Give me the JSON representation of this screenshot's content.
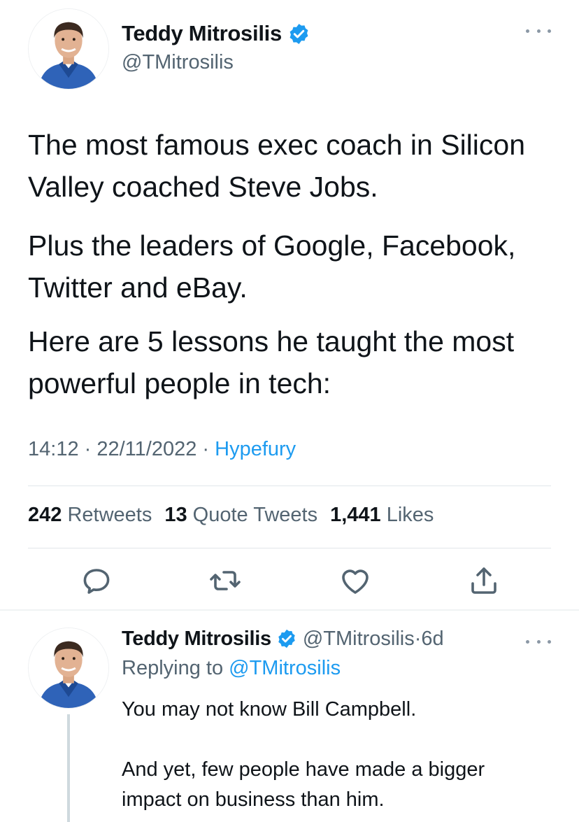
{
  "main_tweet": {
    "author_name": "Teddy Mitrosilis",
    "handle": "@TMitrosilis",
    "avatar_icon": "profile-photo",
    "verified_icon": "verified-badge-icon",
    "paragraphs": [
      "The most famous exec coach in Silicon Valley coached Steve Jobs.",
      "Plus the leaders of Google, Facebook, Twitter and eBay.",
      "Here are 5 lessons he taught the most powerful people in tech:"
    ],
    "time": "14:12",
    "date": "22/11/2022",
    "source": "Hypefury",
    "separator": " · ",
    "stats": {
      "retweets_count": "242",
      "retweets_label": "Retweets",
      "quotes_count": "13",
      "quotes_label": "Quote Tweets",
      "likes_count": "1,441",
      "likes_label": "Likes"
    },
    "actions": [
      "reply-icon",
      "retweet-icon",
      "like-icon",
      "share-icon"
    ]
  },
  "reply_tweet": {
    "author_name": "Teddy Mitrosilis",
    "handle": "@TMitrosilis",
    "age": "6d",
    "meta_separator": " · ",
    "replying_prefix": "Replying to ",
    "replying_handle": "@TMitrosilis",
    "lines": [
      "You may not know Bill Campbell.",
      "",
      "And yet, few people have made a bigger",
      "impact on business than him."
    ]
  },
  "colors": {
    "text": "#0f1419",
    "secondary": "#536471",
    "accent": "#1d9bf0",
    "divider": "#e1e6ea"
  }
}
